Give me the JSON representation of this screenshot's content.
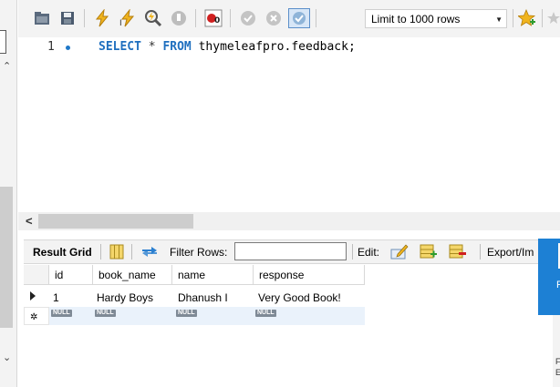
{
  "toolbar": {
    "limit_label": "Limit to 1000 rows",
    "icons": [
      "folder-icon",
      "save-icon",
      "execute-icon",
      "execute-current-icon",
      "explain-icon",
      "stop-icon",
      "toggle-error-icon",
      "commit-icon",
      "rollback-icon",
      "autocommit-icon",
      "bookmark-icon"
    ]
  },
  "editor": {
    "line_number": "1",
    "tokens": {
      "select": "SELECT",
      "star": "*",
      "from": "FROM",
      "table": "thymeleafpro.feedback;"
    }
  },
  "results": {
    "grid_label": "Result Grid",
    "filter_label": "Filter Rows:",
    "filter_value": "",
    "edit_label": "Edit:",
    "export_label": "Export/Im",
    "columns": [
      "id",
      "book_name",
      "name",
      "response"
    ],
    "rows": [
      {
        "id": "1",
        "book_name": "Hardy Boys",
        "name": "Dhanush I",
        "response": "Very Good Book!"
      }
    ],
    "null_label": "NULL"
  },
  "right_panel": {
    "label": "R",
    "side_l1": "F",
    "side_l2": "E"
  },
  "colors": {
    "keyword": "#1f6fbf",
    "accent": "#1d80d4",
    "null_badge": "#7f8a96",
    "new_row_bg": "#eaf2fb"
  }
}
